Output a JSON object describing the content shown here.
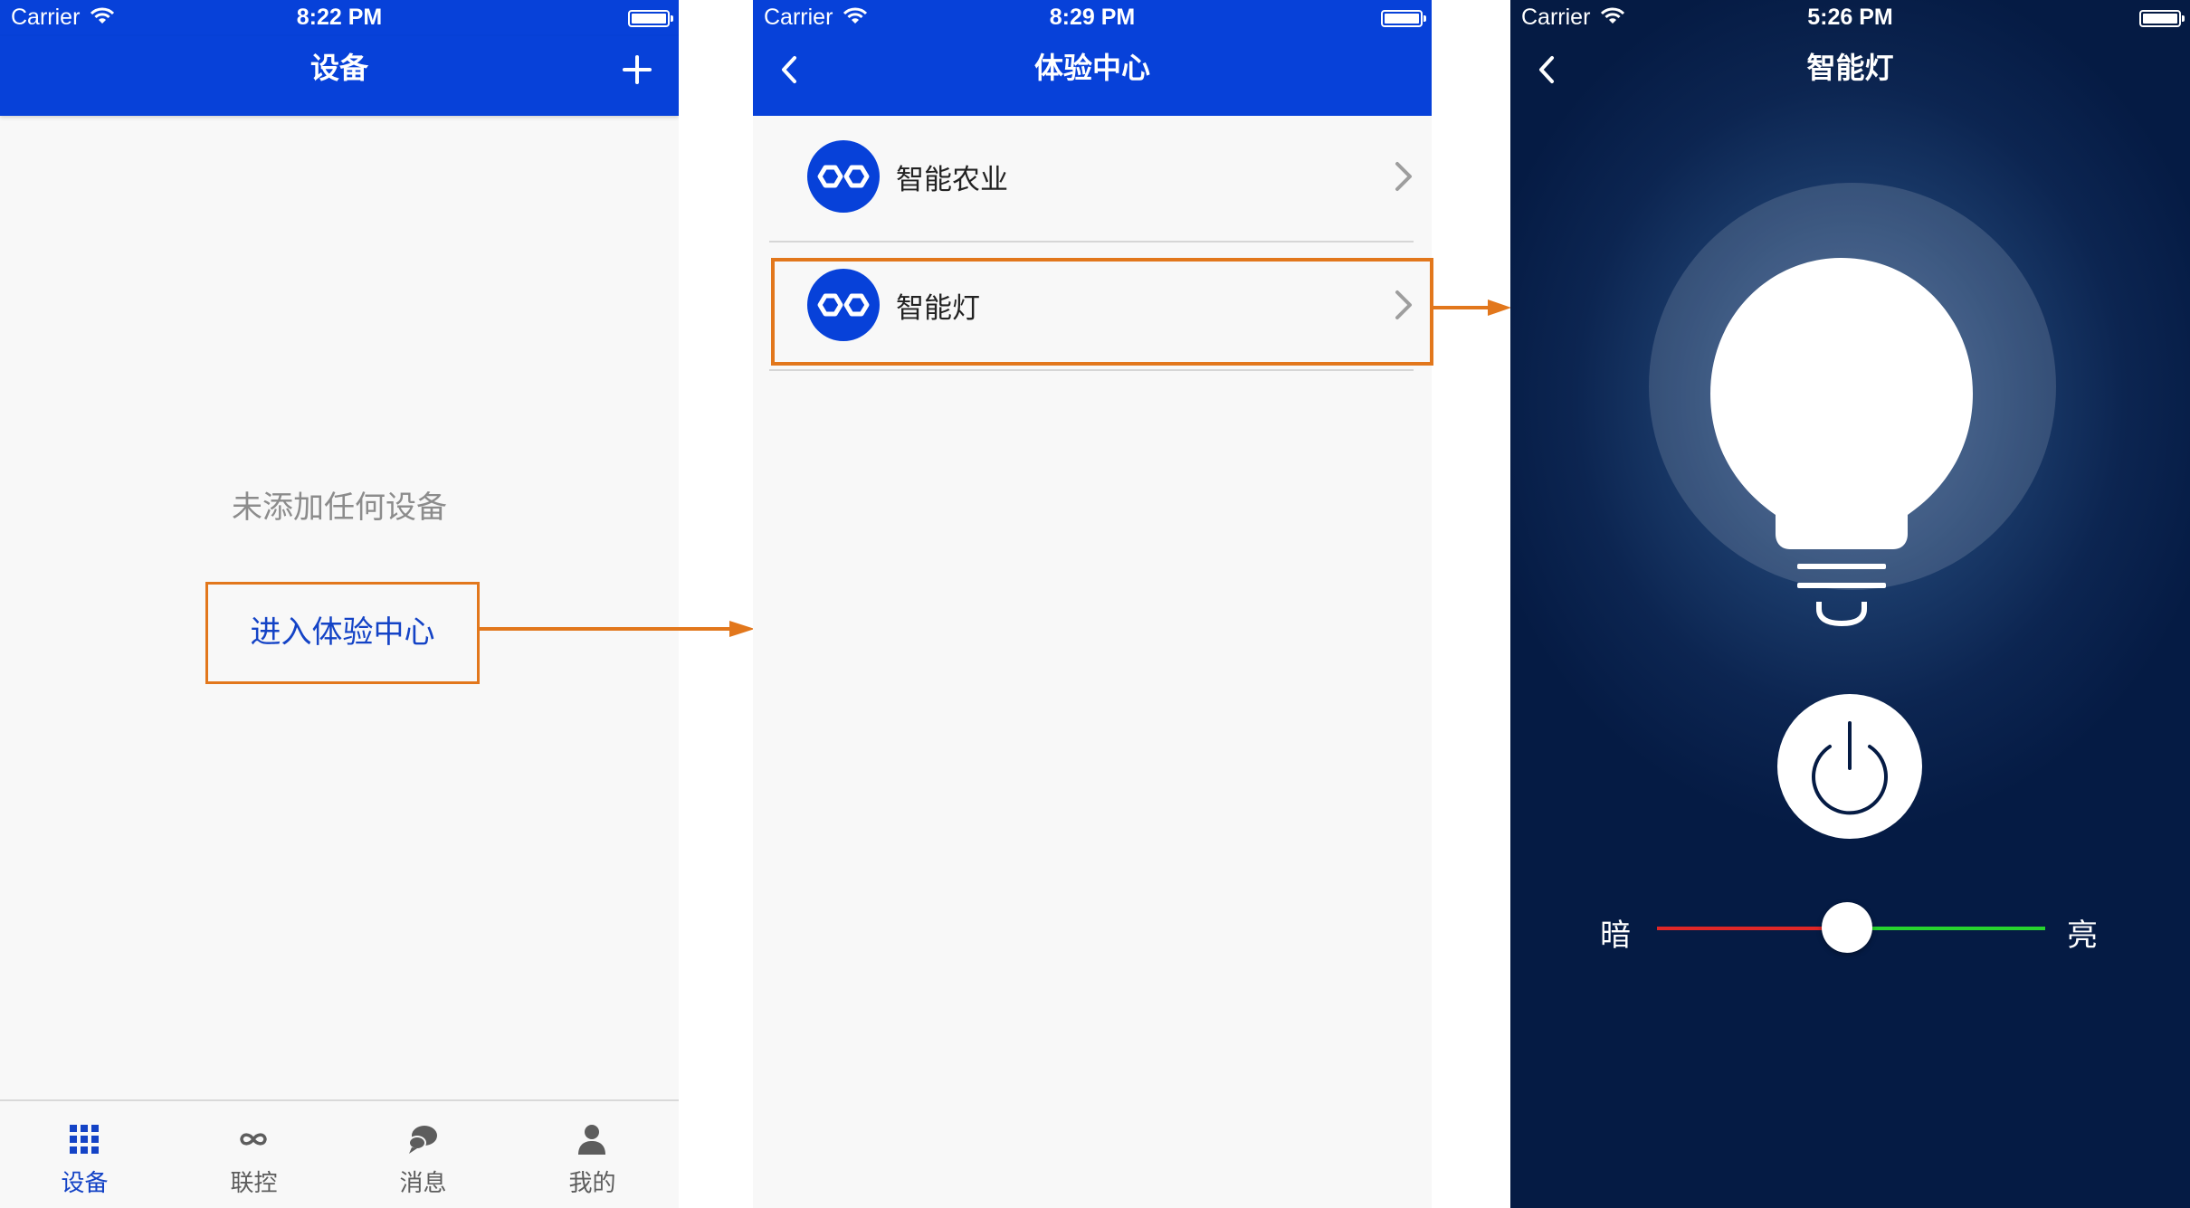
{
  "colors": {
    "nav_blue": "#0741d9",
    "annotation_orange": "#e2771c",
    "lamp_bg": "#051b44",
    "track_dark": "#e12727",
    "track_bright": "#27d42e"
  },
  "screens": [
    {
      "status": {
        "carrier": "Carrier",
        "time": "8:22 PM"
      },
      "nav_title": "设备",
      "empty_text": "未添加任何设备",
      "enter_button": "进入体验中心",
      "tabs": [
        {
          "label": "设备",
          "icon": "grid-icon",
          "active": true
        },
        {
          "label": "联控",
          "icon": "infinity-icon",
          "active": false
        },
        {
          "label": "消息",
          "icon": "chat-bubbles-icon",
          "active": false
        },
        {
          "label": "我的",
          "icon": "person-icon",
          "active": false
        }
      ]
    },
    {
      "status": {
        "carrier": "Carrier",
        "time": "8:29 PM"
      },
      "nav_title": "体验中心",
      "items": [
        {
          "label": "智能农业",
          "icon": "link-icon"
        },
        {
          "label": "智能灯",
          "icon": "link-icon",
          "highlighted": true
        }
      ]
    },
    {
      "status": {
        "carrier": "Carrier",
        "time": "5:26 PM"
      },
      "nav_title": "智能灯",
      "brightness": {
        "dark_label": "暗",
        "bright_label": "亮",
        "value": 0.49
      }
    }
  ]
}
